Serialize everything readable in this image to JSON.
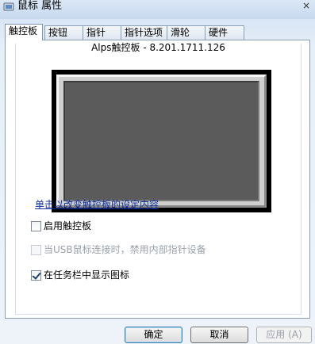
{
  "window": {
    "title": "鼠标 属性",
    "title_icon": "mouse-icon",
    "close_glyph": "×"
  },
  "tabs": [
    {
      "label": "触控板",
      "active": true
    },
    {
      "label": "按钮",
      "active": false
    },
    {
      "label": "指针",
      "active": false
    },
    {
      "label": "指针选项",
      "active": false
    },
    {
      "label": "滑轮",
      "active": false
    },
    {
      "label": "硬件",
      "active": false
    }
  ],
  "touchpad": {
    "version": "Alps触控板 - 8.201.1711.126",
    "settings_link": "单击以改变触控板的设定内容"
  },
  "options": [
    {
      "label": "启用触控板",
      "checked": false,
      "enabled": true
    },
    {
      "label": "当USB鼠标连接时，禁用内部指针设备",
      "checked": false,
      "enabled": false
    },
    {
      "label": "在任务栏中显示图标",
      "checked": true,
      "enabled": true
    }
  ],
  "buttons": {
    "ok": "确定",
    "cancel": "取消",
    "apply": "应用 (A)"
  },
  "colors": {
    "link": "#0d2f9c",
    "pad_surface": "#5b5b5b"
  }
}
